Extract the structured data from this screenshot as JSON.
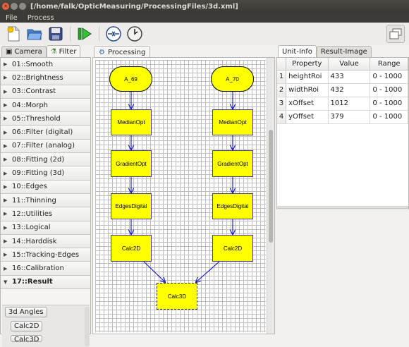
{
  "window": {
    "title": "[/home/falk/OpticMeasuring/ProcessingFiles/3d.xml]"
  },
  "menu": [
    {
      "label": "File"
    },
    {
      "label": "Process"
    }
  ],
  "left_tabs": [
    {
      "label": "Camera"
    },
    {
      "label": "Filter"
    }
  ],
  "steps": [
    {
      "label": "01::Smooth"
    },
    {
      "label": "02::Brightness"
    },
    {
      "label": "03::Contrast"
    },
    {
      "label": "04::Morph"
    },
    {
      "label": "05::Threshold"
    },
    {
      "label": "06::Filter (digital)"
    },
    {
      "label": "07::Filter (analog)"
    },
    {
      "label": "08::Fitting (2d)"
    },
    {
      "label": "09::Fitting (3d)"
    },
    {
      "label": "10::Edges"
    },
    {
      "label": "11::Thinning"
    },
    {
      "label": "12::Utilities"
    },
    {
      "label": "13::Logical"
    },
    {
      "label": "14::Harddisk"
    },
    {
      "label": "15::Tracking-Edges"
    },
    {
      "label": "16::Calibration"
    },
    {
      "label": "17::Result"
    }
  ],
  "result_buttons": [
    {
      "label": "3d Angles"
    },
    {
      "label": "Calc2D"
    },
    {
      "label": "Calc3D"
    }
  ],
  "processing_tab": {
    "label": "Processing"
  },
  "nodes": {
    "a69": "A_69",
    "a70": "A_70",
    "median_l": "MedianOpt",
    "median_r": "MedianOpt",
    "gradient_l": "GradientOpt",
    "gradient_r": "GradientOpt",
    "edges_l": "EdgesDigital",
    "edges_r": "EdgesDigital",
    "calc2d_l": "Calc2D",
    "calc2d_r": "Calc2D",
    "calc3d": "Calc3D"
  },
  "right_tabs": [
    {
      "label": "Unit-Info"
    },
    {
      "label": "Result-Image"
    }
  ],
  "table": {
    "headers": [
      "Property",
      "Value",
      "Range"
    ],
    "rows": [
      {
        "num": "1",
        "property": "heightRoi",
        "value": "433",
        "range": "0 - 1000"
      },
      {
        "num": "2",
        "property": "widthRoi",
        "value": "432",
        "range": "0 - 1000"
      },
      {
        "num": "3",
        "property": "xOffset",
        "value": "1012",
        "range": "0 - 1000"
      },
      {
        "num": "4",
        "property": "yOffset",
        "value": "379",
        "range": "0 - 1000"
      }
    ]
  },
  "colors": {
    "node_fill": "#ffff00",
    "edge": "#1010c8",
    "titlebar": "#3c3b37",
    "close_button": "#e8663f"
  },
  "icons": [
    "new-file-icon",
    "open-folder-icon",
    "save-icon",
    "run-icon",
    "connect-icon",
    "clock-icon",
    "window-icon"
  ]
}
